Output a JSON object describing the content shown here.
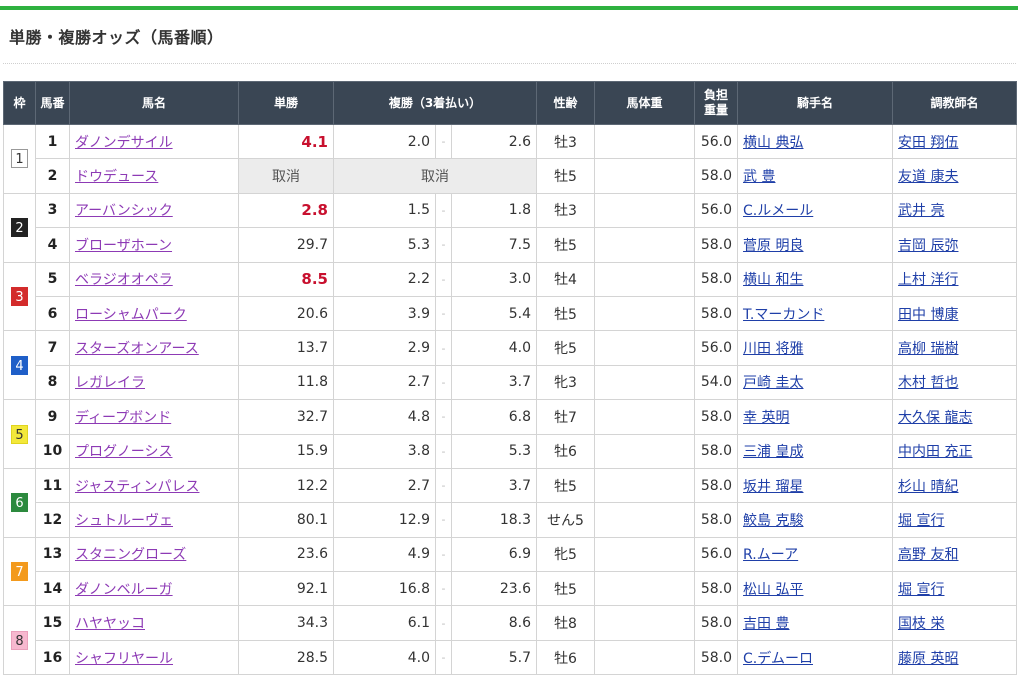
{
  "page": {
    "title": "単勝・複勝オッズ（馬番順）"
  },
  "colors": {
    "accent": "#2eb13f",
    "header_bg": "#3a4654",
    "favorite": "#c8102e"
  },
  "table": {
    "headers": [
      "枠",
      "馬番",
      "馬名",
      "単勝",
      "複勝（3着払い）",
      "性齢",
      "馬体重",
      "負担\n重量",
      "騎手名",
      "調教師名"
    ],
    "scratch_label": "取消",
    "rows": [
      {
        "waku": "1",
        "num": "1",
        "name": "ダノンデサイル",
        "win": "4.1",
        "hot": true,
        "p_lo": "2.0",
        "p_hi": "2.6",
        "sex": "牡3",
        "bw": "",
        "wt": "56.0",
        "jockey": "横山 典弘",
        "trainer": "安田 翔伍"
      },
      {
        "waku": "1",
        "num": "2",
        "name": "ドウデュース",
        "win": "取消",
        "scratched": true,
        "p_lo": "",
        "p_hi": "",
        "sex": "牡5",
        "bw": "",
        "wt": "58.0",
        "jockey": "武 豊",
        "trainer": "友道 康夫"
      },
      {
        "waku": "2",
        "num": "3",
        "name": "アーバンシック",
        "win": "2.8",
        "hot": true,
        "p_lo": "1.5",
        "p_hi": "1.8",
        "sex": "牡3",
        "bw": "",
        "wt": "56.0",
        "jockey": "C.ルメール",
        "trainer": "武井 亮"
      },
      {
        "waku": "2",
        "num": "4",
        "name": "ブローザホーン",
        "win": "29.7",
        "p_lo": "5.3",
        "p_hi": "7.5",
        "sex": "牡5",
        "bw": "",
        "wt": "58.0",
        "jockey": "菅原 明良",
        "trainer": "吉岡 辰弥"
      },
      {
        "waku": "3",
        "num": "5",
        "name": "ベラジオオペラ",
        "win": "8.5",
        "hot": true,
        "p_lo": "2.2",
        "p_hi": "3.0",
        "sex": "牡4",
        "bw": "",
        "wt": "58.0",
        "jockey": "横山 和生",
        "trainer": "上村 洋行"
      },
      {
        "waku": "3",
        "num": "6",
        "name": "ローシャムパーク",
        "win": "20.6",
        "p_lo": "3.9",
        "p_hi": "5.4",
        "sex": "牡5",
        "bw": "",
        "wt": "58.0",
        "jockey": "T.マーカンド",
        "trainer": "田中 博康"
      },
      {
        "waku": "4",
        "num": "7",
        "name": "スターズオンアース",
        "win": "13.7",
        "p_lo": "2.9",
        "p_hi": "4.0",
        "sex": "牝5",
        "bw": "",
        "wt": "56.0",
        "jockey": "川田 将雅",
        "trainer": "高柳 瑞樹"
      },
      {
        "waku": "4",
        "num": "8",
        "name": "レガレイラ",
        "win": "11.8",
        "p_lo": "2.7",
        "p_hi": "3.7",
        "sex": "牝3",
        "bw": "",
        "wt": "54.0",
        "jockey": "戸崎 圭太",
        "trainer": "木村 哲也"
      },
      {
        "waku": "5",
        "num": "9",
        "name": "ディープボンド",
        "win": "32.7",
        "p_lo": "4.8",
        "p_hi": "6.8",
        "sex": "牡7",
        "bw": "",
        "wt": "58.0",
        "jockey": "幸 英明",
        "trainer": "大久保 龍志"
      },
      {
        "waku": "5",
        "num": "10",
        "name": "プログノーシス",
        "win": "15.9",
        "p_lo": "3.8",
        "p_hi": "5.3",
        "sex": "牡6",
        "bw": "",
        "wt": "58.0",
        "jockey": "三浦 皇成",
        "trainer": "中内田 充正"
      },
      {
        "waku": "6",
        "num": "11",
        "name": "ジャスティンパレス",
        "win": "12.2",
        "p_lo": "2.7",
        "p_hi": "3.7",
        "sex": "牡5",
        "bw": "",
        "wt": "58.0",
        "jockey": "坂井 瑠星",
        "trainer": "杉山 晴紀"
      },
      {
        "waku": "6",
        "num": "12",
        "name": "シュトルーヴェ",
        "win": "80.1",
        "p_lo": "12.9",
        "p_hi": "18.3",
        "sex": "せん5",
        "bw": "",
        "wt": "58.0",
        "jockey": "鮫島 克駿",
        "trainer": "堀 宣行"
      },
      {
        "waku": "7",
        "num": "13",
        "name": "スタニングローズ",
        "win": "23.6",
        "p_lo": "4.9",
        "p_hi": "6.9",
        "sex": "牝5",
        "bw": "",
        "wt": "56.0",
        "jockey": "R.ムーア",
        "trainer": "高野 友和"
      },
      {
        "waku": "7",
        "num": "14",
        "name": "ダノンベルーガ",
        "win": "92.1",
        "p_lo": "16.8",
        "p_hi": "23.6",
        "sex": "牡5",
        "bw": "",
        "wt": "58.0",
        "jockey": "松山 弘平",
        "trainer": "堀 宣行"
      },
      {
        "waku": "8",
        "num": "15",
        "name": "ハヤヤッコ",
        "win": "34.3",
        "p_lo": "6.1",
        "p_hi": "8.6",
        "sex": "牡8",
        "bw": "",
        "wt": "58.0",
        "jockey": "吉田 豊",
        "trainer": "国枝 栄"
      },
      {
        "waku": "8",
        "num": "16",
        "name": "シャフリヤール",
        "win": "28.5",
        "p_lo": "4.0",
        "p_hi": "5.7",
        "sex": "牡6",
        "bw": "",
        "wt": "58.0",
        "jockey": "C.デムーロ",
        "trainer": "藤原 英昭"
      }
    ]
  },
  "waku_colors": {
    "1": {
      "bg": "#ffffff",
      "fg": "#333333",
      "border": "#999999"
    },
    "2": {
      "bg": "#222222",
      "fg": "#ffffff",
      "border": "#222222"
    },
    "3": {
      "bg": "#d32b2b",
      "fg": "#ffffff",
      "border": "#d32b2b"
    },
    "4": {
      "bg": "#1f5fc8",
      "fg": "#ffffff",
      "border": "#1f5fc8"
    },
    "5": {
      "bg": "#f3e83a",
      "fg": "#333333",
      "border": "#e0d41f"
    },
    "6": {
      "bg": "#2c8a3e",
      "fg": "#ffffff",
      "border": "#2c8a3e"
    },
    "7": {
      "bg": "#f39a1d",
      "fg": "#ffffff",
      "border": "#f39a1d"
    },
    "8": {
      "bg": "#f7b8cf",
      "fg": "#333333",
      "border": "#eaa0bb"
    }
  }
}
